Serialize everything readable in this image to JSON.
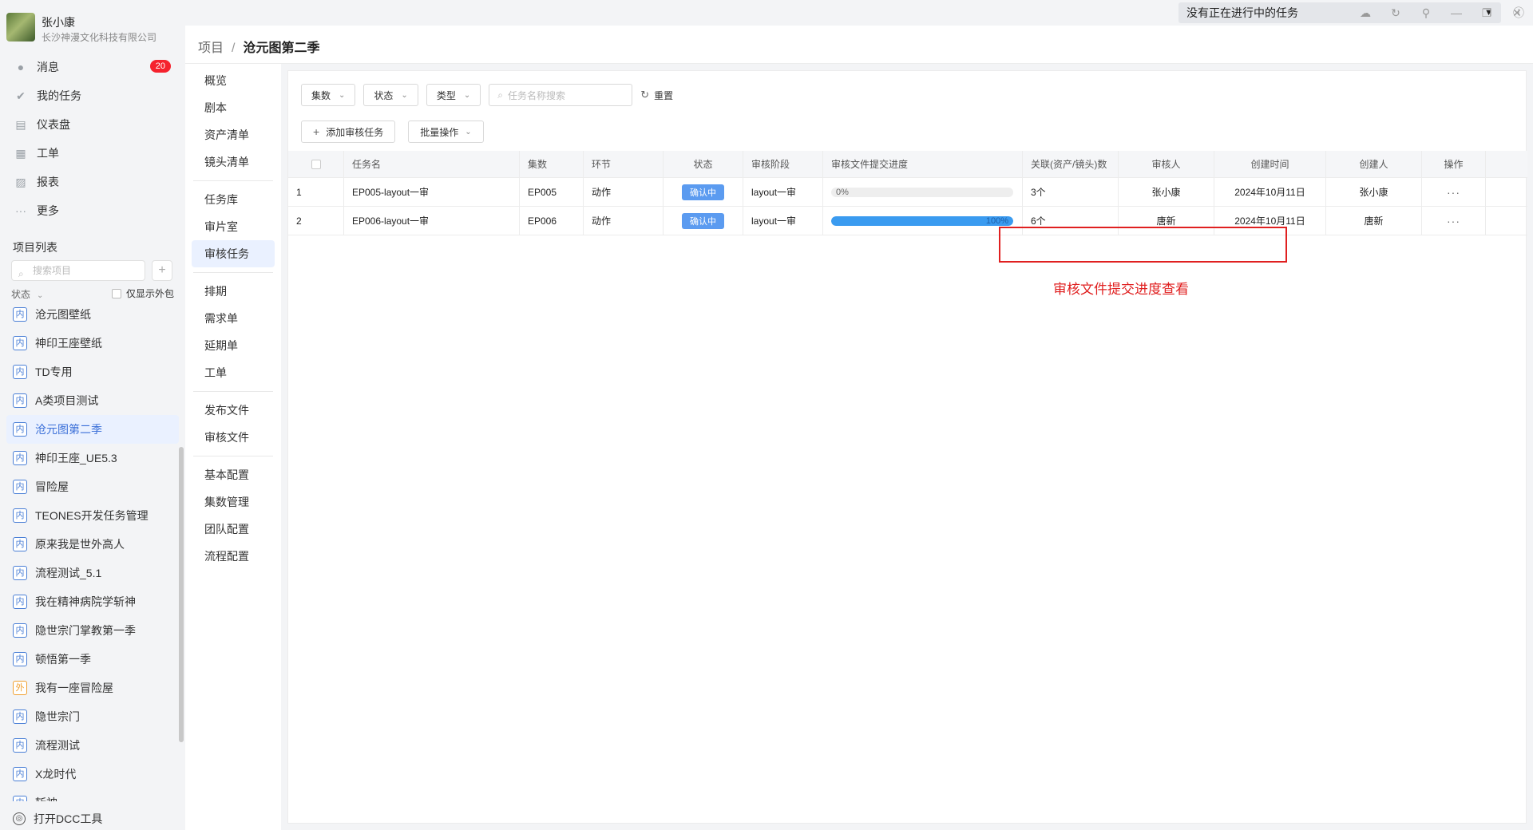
{
  "user": {
    "name": "张小康",
    "company": "长沙神漫文化科技有限公司"
  },
  "nav": [
    {
      "label": "消息",
      "icon": "message-icon",
      "badge": "20"
    },
    {
      "label": "我的任务",
      "icon": "check-icon"
    },
    {
      "label": "仪表盘",
      "icon": "dashboard-icon"
    },
    {
      "label": "工单",
      "icon": "ticket-icon"
    },
    {
      "label": "报表",
      "icon": "report-icon"
    },
    {
      "label": "更多",
      "icon": "more-icon"
    }
  ],
  "project_list": {
    "title": "项目列表",
    "search_placeholder": "搜索项目",
    "status_filter": "状态",
    "only_outsource": "仅显示外包",
    "items": [
      {
        "tag": "内",
        "name": "沧元图壁纸"
      },
      {
        "tag": "内",
        "name": "神印王座壁纸"
      },
      {
        "tag": "内",
        "name": "TD专用"
      },
      {
        "tag": "内",
        "name": "A类项目测试"
      },
      {
        "tag": "内",
        "name": "沧元图第二季",
        "active": true
      },
      {
        "tag": "内",
        "name": "神印王座_UE5.3"
      },
      {
        "tag": "内",
        "name": "冒险屋"
      },
      {
        "tag": "内",
        "name": "TEONES开发任务管理"
      },
      {
        "tag": "内",
        "name": "原来我是世外高人"
      },
      {
        "tag": "内",
        "name": "流程测试_5.1"
      },
      {
        "tag": "内",
        "name": "我在精神病院学斩神"
      },
      {
        "tag": "内",
        "name": "隐世宗门掌教第一季"
      },
      {
        "tag": "内",
        "name": "顿悟第一季"
      },
      {
        "tag": "外",
        "name": "我有一座冒险屋"
      },
      {
        "tag": "内",
        "name": "隐世宗门"
      },
      {
        "tag": "内",
        "name": "流程测试"
      },
      {
        "tag": "内",
        "name": "X龙时代"
      },
      {
        "tag": "内",
        "name": "斩神"
      }
    ]
  },
  "dcc_label": "打开DCC工具",
  "topbar": {
    "task_status": "没有正在进行中的任务"
  },
  "breadcrumb": {
    "root": "项目",
    "sep": "/",
    "current": "沧元图第二季"
  },
  "subnav": [
    [
      "概览",
      "剧本",
      "资产清单",
      "镜头清单"
    ],
    [
      "任务库",
      "审片室",
      "审核任务"
    ],
    [
      "排期",
      "需求单",
      "延期单",
      "工单"
    ],
    [
      "发布文件",
      "审核文件"
    ],
    [
      "基本配置",
      "集数管理",
      "团队配置",
      "流程配置"
    ]
  ],
  "subnav_active": "审核任务",
  "toolbar": {
    "episode": "集数",
    "status": "状态",
    "type": "类型",
    "search_placeholder": "任务名称搜索",
    "reset": "重置",
    "add_review": "添加审核任务",
    "batch": "批量操作"
  },
  "table": {
    "columns": [
      "",
      "任务名",
      "集数",
      "环节",
      "状态",
      "审核阶段",
      "审核文件提交进度",
      "关联(资产/镜头)数",
      "审核人",
      "创建时间",
      "创建人",
      "操作"
    ],
    "rows": [
      {
        "idx": "1",
        "name": "EP005-layout一审",
        "episode": "EP005",
        "stage": "动作",
        "status": "确认中",
        "review_stage": "layout一审",
        "progress": 0,
        "progress_label": "0%",
        "count": "3个",
        "reviewer": "张小康",
        "created": "2024年10月11日",
        "creator": "张小康",
        "op": "···"
      },
      {
        "idx": "2",
        "name": "EP006-layout一审",
        "episode": "EP006",
        "stage": "动作",
        "status": "确认中",
        "review_stage": "layout一审",
        "progress": 100,
        "progress_label": "100%",
        "count": "6个",
        "reviewer": "唐新",
        "created": "2024年10月11日",
        "creator": "唐新",
        "op": "···"
      }
    ]
  },
  "annotation": "审核文件提交进度查看",
  "colors": {
    "accent": "#3a9bf0",
    "annotation": "#e02020",
    "badge": "#f5222d"
  }
}
